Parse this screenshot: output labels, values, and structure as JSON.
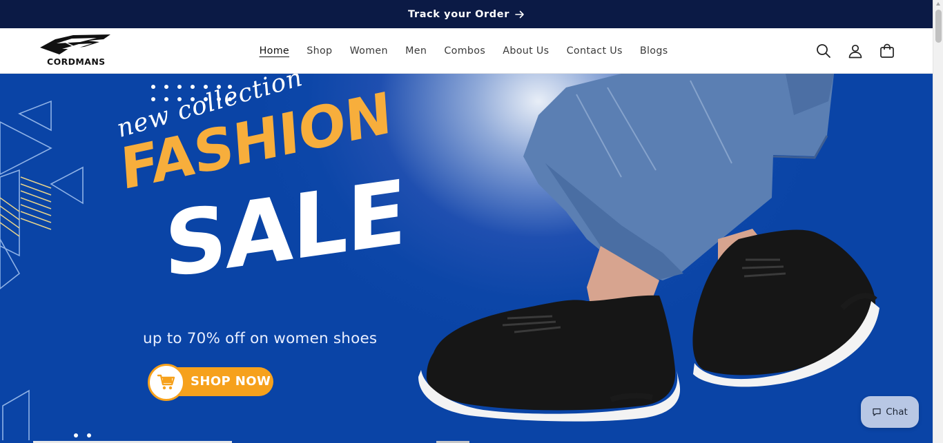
{
  "announcement": {
    "label": "Track your Order"
  },
  "brand": {
    "name": "CORDMANS"
  },
  "nav": {
    "items": [
      {
        "label": "Home",
        "active": true
      },
      {
        "label": "Shop"
      },
      {
        "label": "Women"
      },
      {
        "label": "Men"
      },
      {
        "label": "Combos"
      },
      {
        "label": "About Us"
      },
      {
        "label": "Contact Us"
      },
      {
        "label": "Blogs"
      }
    ]
  },
  "header_icons": [
    "search-icon",
    "account-icon",
    "cart-icon"
  ],
  "hero": {
    "script_text": "new collection",
    "headline_1": "FASHION",
    "headline_2": "SALE",
    "subtext": "up to 70% off on women shoes",
    "cta_label": "SHOP NOW",
    "colors": {
      "background": "#0a44a6",
      "accent": "#f6a11c",
      "headline_1": "#f7ae3c"
    }
  },
  "chat": {
    "label": "Chat"
  },
  "colors": {
    "announcement_bg": "#0b1a45",
    "chat_bg": "#b8c7e4"
  }
}
